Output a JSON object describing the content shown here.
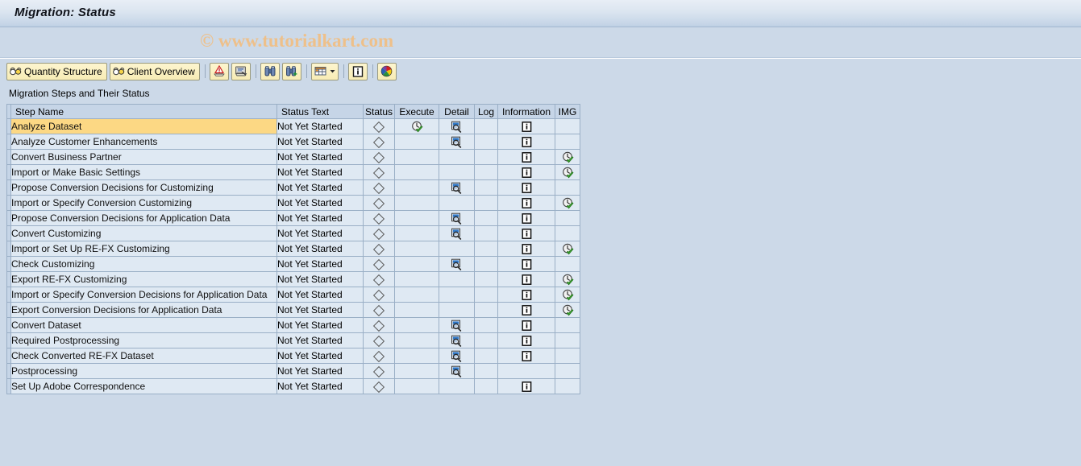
{
  "window": {
    "title": "Migration: Status"
  },
  "watermark": {
    "text": "© www.tutorialkart.com"
  },
  "toolbar": {
    "buttons": [
      {
        "label": "Quantity Structure",
        "icon": "glasses-icon"
      },
      {
        "label": "Client Overview",
        "icon": "glasses-icon"
      }
    ],
    "icon_buttons": [
      {
        "name": "check-warning-icon",
        "title": ""
      },
      {
        "name": "monitor-script-icon",
        "title": ""
      },
      {
        "name": "find-binoculars-icon",
        "title": ""
      },
      {
        "name": "find-next-binoculars-icon",
        "title": ""
      },
      {
        "name": "layout-table-icon",
        "title": ""
      },
      {
        "name": "info-details-icon",
        "title": ""
      },
      {
        "name": "color-palette-icon",
        "title": ""
      }
    ]
  },
  "section": {
    "label": "Migration Steps and Their Status"
  },
  "table": {
    "columns": [
      {
        "key": "step_name",
        "label": "Step Name",
        "align": "left"
      },
      {
        "key": "status_text",
        "label": "Status Text",
        "align": "left"
      },
      {
        "key": "status",
        "label": "Status",
        "align": "center"
      },
      {
        "key": "execute",
        "label": "Execute",
        "align": "center"
      },
      {
        "key": "detail",
        "label": "Detail",
        "align": "center"
      },
      {
        "key": "log",
        "label": "Log",
        "align": "center"
      },
      {
        "key": "information",
        "label": "Information",
        "align": "center"
      },
      {
        "key": "img",
        "label": "IMG",
        "align": "center"
      }
    ],
    "rows": [
      {
        "step_name": "Analyze Dataset",
        "status_text": "Not Yet Started",
        "status": "diamond",
        "execute": "clock-check-icon",
        "detail": "magnifier-document-icon",
        "log": "",
        "information": "info-icon",
        "img": "",
        "selected": true
      },
      {
        "step_name": "Analyze Customer Enhancements",
        "status_text": "Not Yet Started",
        "status": "diamond",
        "execute": "",
        "detail": "magnifier-document-icon",
        "log": "",
        "information": "info-icon",
        "img": "",
        "selected": false
      },
      {
        "step_name": "Convert Business Partner",
        "status_text": "Not Yet Started",
        "status": "diamond",
        "execute": "",
        "detail": "",
        "log": "",
        "information": "info-icon",
        "img": "clock-check-icon",
        "selected": false
      },
      {
        "step_name": "Import or Make Basic Settings",
        "status_text": "Not Yet Started",
        "status": "diamond",
        "execute": "",
        "detail": "",
        "log": "",
        "information": "info-icon",
        "img": "clock-check-icon",
        "selected": false
      },
      {
        "step_name": "Propose Conversion Decisions for Customizing",
        "status_text": "Not Yet Started",
        "status": "diamond",
        "execute": "",
        "detail": "magnifier-document-icon",
        "log": "",
        "information": "info-icon",
        "img": "",
        "selected": false
      },
      {
        "step_name": "Import or Specify Conversion Customizing",
        "status_text": "Not Yet Started",
        "status": "diamond",
        "execute": "",
        "detail": "",
        "log": "",
        "information": "info-icon",
        "img": "clock-check-icon",
        "selected": false
      },
      {
        "step_name": "Propose Conversion Decisions for Application Data",
        "status_text": "Not Yet Started",
        "status": "diamond",
        "execute": "",
        "detail": "magnifier-document-icon",
        "log": "",
        "information": "info-icon",
        "img": "",
        "selected": false
      },
      {
        "step_name": "Convert Customizing",
        "status_text": "Not Yet Started",
        "status": "diamond",
        "execute": "",
        "detail": "magnifier-document-icon",
        "log": "",
        "information": "info-icon",
        "img": "",
        "selected": false
      },
      {
        "step_name": "Import or Set Up RE-FX Customizing",
        "status_text": "Not Yet Started",
        "status": "diamond",
        "execute": "",
        "detail": "",
        "log": "",
        "information": "info-icon",
        "img": "clock-check-icon",
        "selected": false
      },
      {
        "step_name": "Check Customizing",
        "status_text": "Not Yet Started",
        "status": "diamond",
        "execute": "",
        "detail": "magnifier-document-icon",
        "log": "",
        "information": "info-icon",
        "img": "",
        "selected": false
      },
      {
        "step_name": "Export RE-FX Customizing",
        "status_text": "Not Yet Started",
        "status": "diamond",
        "execute": "",
        "detail": "",
        "log": "",
        "information": "info-icon",
        "img": "clock-check-icon",
        "selected": false
      },
      {
        "step_name": "Import or Specify Conversion Decisions for Application Data",
        "status_text": "Not Yet Started",
        "status": "diamond",
        "execute": "",
        "detail": "",
        "log": "",
        "information": "info-icon",
        "img": "clock-check-icon",
        "selected": false
      },
      {
        "step_name": "Export Conversion Decisions for Application Data",
        "status_text": "Not Yet Started",
        "status": "diamond",
        "execute": "",
        "detail": "",
        "log": "",
        "information": "info-icon",
        "img": "clock-check-icon",
        "selected": false
      },
      {
        "step_name": "Convert Dataset",
        "status_text": "Not Yet Started",
        "status": "diamond",
        "execute": "",
        "detail": "magnifier-document-icon",
        "log": "",
        "information": "info-icon",
        "img": "",
        "selected": false
      },
      {
        "step_name": "Required Postprocessing",
        "status_text": "Not Yet Started",
        "status": "diamond",
        "execute": "",
        "detail": "magnifier-document-icon",
        "log": "",
        "information": "info-icon",
        "img": "",
        "selected": false
      },
      {
        "step_name": "Check Converted RE-FX Dataset",
        "status_text": "Not Yet Started",
        "status": "diamond",
        "execute": "",
        "detail": "magnifier-document-icon",
        "log": "",
        "information": "info-icon",
        "img": "",
        "selected": false
      },
      {
        "step_name": "Postprocessing",
        "status_text": "Not Yet Started",
        "status": "diamond",
        "execute": "",
        "detail": "magnifier-document-icon",
        "log": "",
        "information": "",
        "img": "",
        "selected": false
      },
      {
        "step_name": "Set Up Adobe Correspondence",
        "status_text": "Not Yet Started",
        "status": "diamond",
        "execute": "",
        "detail": "",
        "log": "",
        "information": "info-icon",
        "img": "",
        "selected": false
      }
    ]
  },
  "colors": {
    "title_bar": "#dbe5f0",
    "page_background": "#ccd9e8",
    "row_background": "#dfe9f3",
    "selected_row": "#fcd884",
    "header_background": "#c6d5e7",
    "grid_line": "#9aafc6",
    "button_face": "#f7ecb5",
    "watermark": "#eec08a"
  }
}
